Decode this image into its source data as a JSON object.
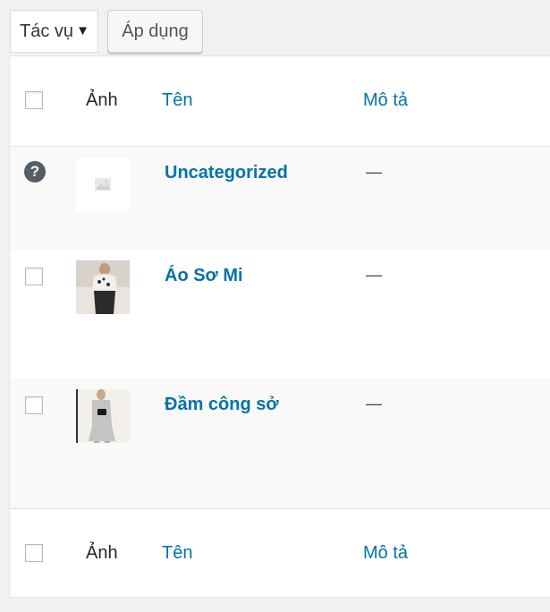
{
  "bulk_actions": {
    "select_value": "Tác vụ",
    "apply_label": "Áp dụng"
  },
  "table": {
    "columns": {
      "image": "Ảnh",
      "name": "Tên",
      "description": "Mô tả"
    },
    "rows": [
      {
        "name": "Uncategorized",
        "description": "—",
        "thumbnail": "placeholder-image",
        "has_checkbox": false,
        "icon": "question-icon"
      },
      {
        "name": "Áo Sơ Mi",
        "description": "—",
        "thumbnail": "shirt-photo",
        "has_checkbox": true
      },
      {
        "name": "Đầm công sở",
        "description": "—",
        "thumbnail": "dress-photo",
        "has_checkbox": true
      }
    ]
  },
  "colors": {
    "link": "#0073aa",
    "alt_row": "#f9f9f9",
    "background": "#f1f1f1"
  }
}
